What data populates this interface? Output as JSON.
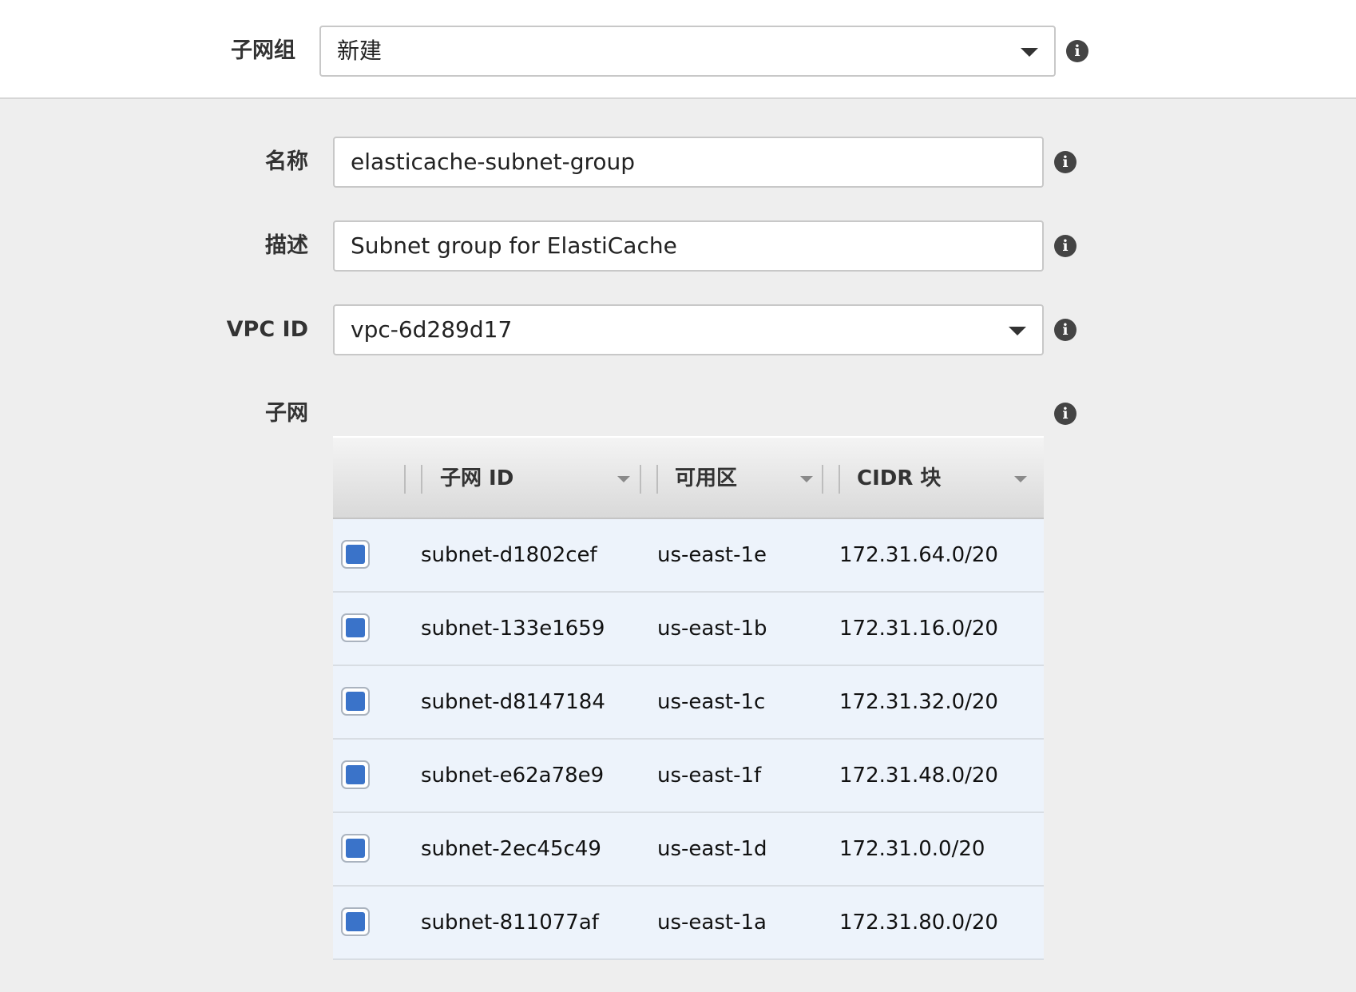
{
  "subnet_group": {
    "label": "子网组",
    "selected": "新建"
  },
  "form": {
    "name": {
      "label": "名称",
      "value": "elasticache-subnet-group"
    },
    "description": {
      "label": "描述",
      "value": "Subnet group for ElastiCache"
    },
    "vpc": {
      "label": "VPC ID",
      "selected": "vpc-6d289d17"
    },
    "subnets": {
      "label": "子网"
    }
  },
  "table": {
    "columns": [
      "子网 ID",
      "可用区",
      "CIDR 块"
    ],
    "rows": [
      {
        "subnet_id": "subnet-d1802cef",
        "az": "us-east-1e",
        "cidr": "172.31.64.0/20",
        "checked": true
      },
      {
        "subnet_id": "subnet-133e1659",
        "az": "us-east-1b",
        "cidr": "172.31.16.0/20",
        "checked": true
      },
      {
        "subnet_id": "subnet-d8147184",
        "az": "us-east-1c",
        "cidr": "172.31.32.0/20",
        "checked": true
      },
      {
        "subnet_id": "subnet-e62a78e9",
        "az": "us-east-1f",
        "cidr": "172.31.48.0/20",
        "checked": true
      },
      {
        "subnet_id": "subnet-2ec45c49",
        "az": "us-east-1d",
        "cidr": "172.31.0.0/20",
        "checked": true
      },
      {
        "subnet_id": "subnet-811077af",
        "az": "us-east-1a",
        "cidr": "172.31.80.0/20",
        "checked": true
      }
    ]
  },
  "icons": {
    "info": "info-icon",
    "dropdown": "chevron-down-icon",
    "sort": "sort-caret-icon"
  },
  "colors": {
    "checkbox_fill": "#3a73c9",
    "row_background": "#edf3fb",
    "page_background": "#eeeeee"
  }
}
